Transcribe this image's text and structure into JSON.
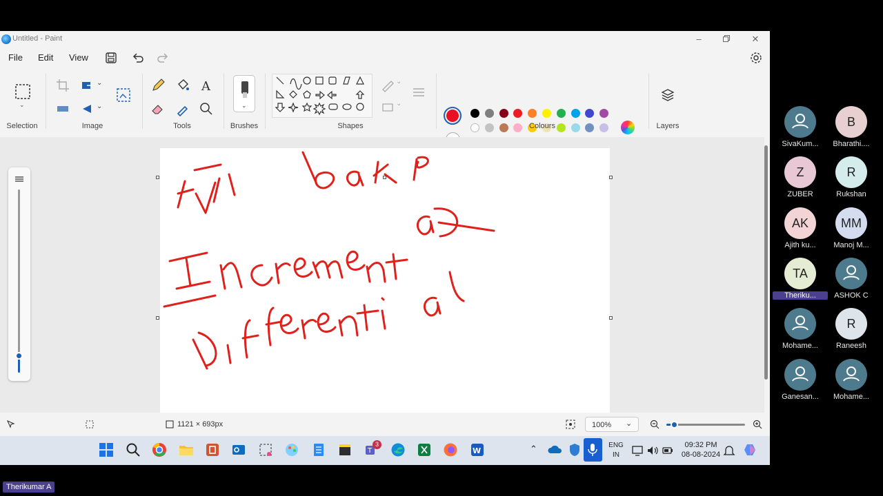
{
  "window": {
    "title": "Untitled - Paint"
  },
  "menu": {
    "file": "File",
    "edit": "Edit",
    "view": "View"
  },
  "ribbon": {
    "groups": {
      "selection": "Selection",
      "image": "Image",
      "tools": "Tools",
      "brushes": "Brushes",
      "shapes": "Shapes",
      "colours": "Colours",
      "layers": "Layers"
    },
    "colors": {
      "selected_primary": "#e81123",
      "row1": [
        "#000000",
        "#7f7f7f",
        "#880015",
        "#ed1c24",
        "#ff7f27",
        "#fff200",
        "#22b14c",
        "#00a2e8",
        "#3f48cc",
        "#a349a4"
      ],
      "row2": [
        "#ffffff",
        "#c3c3c3",
        "#b97a57",
        "#ffaec9",
        "#ffc90e",
        "#efe4b0",
        "#b5e61d",
        "#99d9ea",
        "#7092be",
        "#c8bfe7"
      ]
    }
  },
  "canvas": {
    "handwriting": {
      "line1": "Full backp",
      "line2": "Incremental",
      "line3": "Differential"
    },
    "ink_color": "#e0201b"
  },
  "status": {
    "canvas_size": "1121 × 693px",
    "zoom": "100%",
    "zoom_level": 0.1
  },
  "taskbar": {
    "lang_top": "ENG",
    "lang_bottom": "IN",
    "time": "09:32 PM",
    "date": "08-08-2024",
    "teams_badge": "3"
  },
  "participants": [
    {
      "initials": "",
      "name": "SivaKum...",
      "color": "#4d7a8c"
    },
    {
      "initials": "B",
      "name": "Bharathi....",
      "color": "#e8d0d0"
    },
    {
      "initials": "Z",
      "name": "ZUBER",
      "color": "#e8c8d4"
    },
    {
      "initials": "R",
      "name": "Rukshan",
      "color": "#d4ecec"
    },
    {
      "initials": "AK",
      "name": "Ajith ku...",
      "color": "#f2d4d4"
    },
    {
      "initials": "MM",
      "name": "Manoj M...",
      "color": "#d4dcf0"
    },
    {
      "initials": "TA",
      "name": "Theriku...",
      "color": "#e4ecd4"
    },
    {
      "initials": "",
      "name": "ASHOK C",
      "color": "#4d7a8c"
    },
    {
      "initials": "",
      "name": "Mohame...",
      "color": "#4d7a8c"
    },
    {
      "initials": "R",
      "name": "Raneesh",
      "color": "#dde4ea"
    },
    {
      "initials": "",
      "name": "Ganesan...",
      "color": "#4d7a8c"
    },
    {
      "initials": "",
      "name": "Mohame...",
      "color": "#4d7a8c"
    }
  ],
  "self_name": "Therikumar A"
}
